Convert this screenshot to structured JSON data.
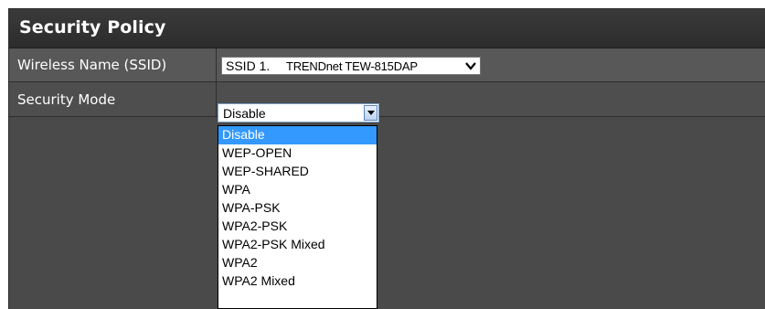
{
  "panel": {
    "title": "Security Policy"
  },
  "ssid_row": {
    "label": "Wireless Name (SSID)",
    "select_prefix": "SSID 1.",
    "select_name": "TRENDnet TEW-815DAP"
  },
  "mode_row": {
    "label": "Security Mode",
    "selected_value": "Disable"
  },
  "dropdown": {
    "options": [
      "Disable",
      "WEP-OPEN",
      "WEP-SHARED",
      "WPA",
      "WPA-PSK",
      "WPA2-PSK",
      "WPA2-PSK Mixed",
      "WPA2",
      "WPA2 Mixed"
    ],
    "highlighted_index": 0
  },
  "colors": {
    "panel_bg": "#4a4a4a",
    "title_bg": "#2c2c2c",
    "highlight": "#3399ff"
  },
  "icons": {
    "ssid_select": "chevron-down-icon",
    "mode_select": "triangle-down-icon"
  }
}
